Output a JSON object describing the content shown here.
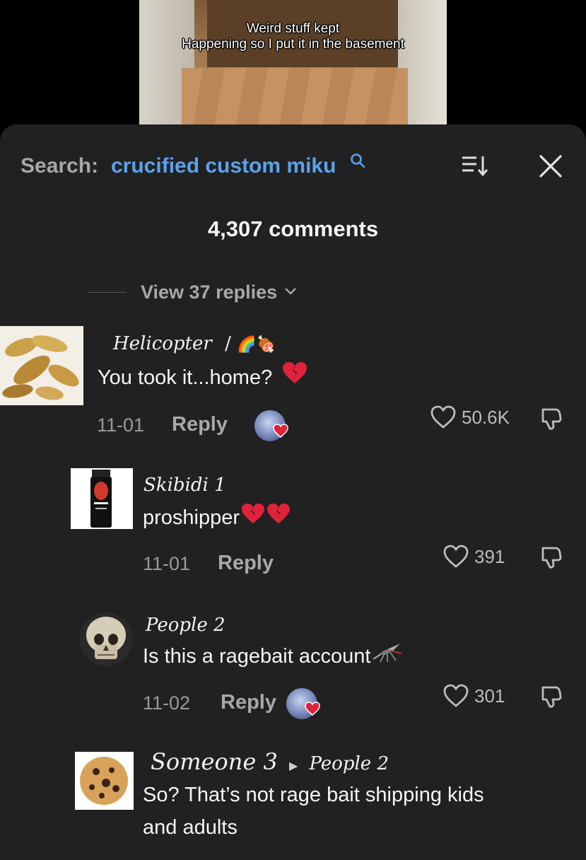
{
  "video": {
    "caption_line1": "Weird stuff kept",
    "caption_line2": "Happening so I put it in the basement"
  },
  "header": {
    "search_prefix": "Search:",
    "search_term": "crucified custom miku",
    "search_icon": "search-icon",
    "sort_icon": "sort-icon",
    "close_icon": "close-icon",
    "comment_count": "4,307 comments"
  },
  "view_replies": "View 37 replies",
  "comments": [
    {
      "username": "Helicopter",
      "badge": "/",
      "emojis": "🌈🍖",
      "text": "You took it...home?",
      "emoji_after": "💔",
      "date": "11-01",
      "reply_label": "Reply",
      "likes": "50.6K"
    },
    {
      "username": "Skibidi 1",
      "text": "proshipper",
      "emoji_after": "💔💔",
      "date": "11-01",
      "reply_label": "Reply",
      "likes": "391"
    },
    {
      "username": "People 2",
      "text": "Is this a ragebait account",
      "emoji_after": "🦟",
      "date": "11-02",
      "reply_label": "Reply",
      "likes": "301"
    },
    {
      "username": "Someone 3",
      "reply_to": "People 2",
      "text_line1": "So? That’s not rage bait shipping kids",
      "text_line2": "and adults"
    }
  ],
  "colors": {
    "sheet_bg": "#212121",
    "accent_blue": "#5aa2ee",
    "muted": "#a8a8a8",
    "heart_red": "#e0233a"
  }
}
